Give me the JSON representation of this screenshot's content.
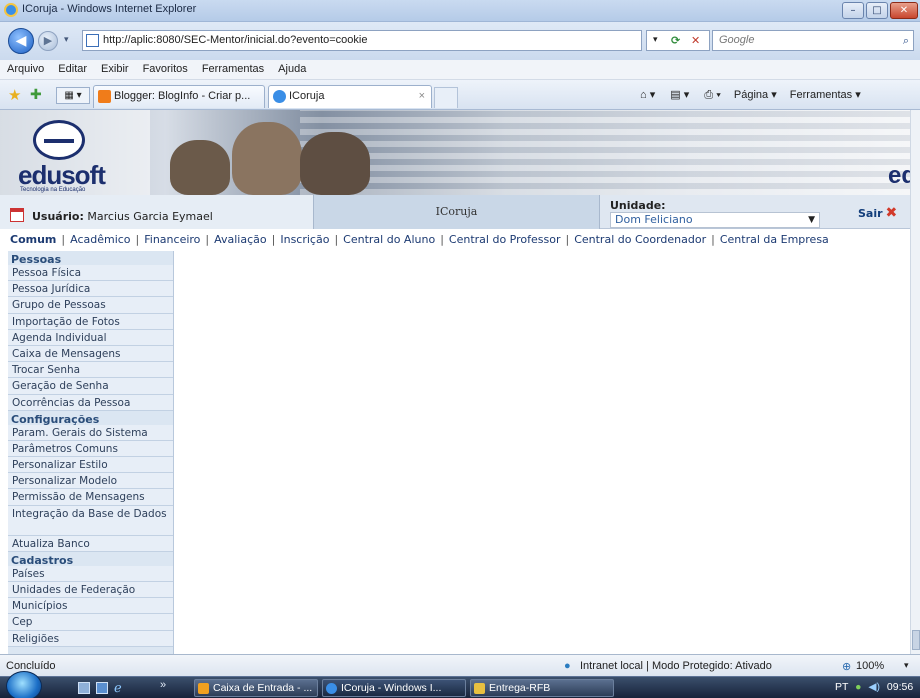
{
  "window": {
    "title": "ICoruja - Windows Internet Explorer",
    "min_label": "–",
    "max_label": "□",
    "close_label": "✕"
  },
  "address": {
    "back_label": "◀",
    "forward_label": "▶",
    "url": "http://aplic:8080/SEC-Mentor/inicial.do?evento=cookie",
    "refresh_label": "⟳",
    "stop_label": "✕",
    "dropdown_label": "▾",
    "search_placeholder": "Google",
    "search_icon": "⌕"
  },
  "menu": [
    "Arquivo",
    "Editar",
    "Exibir",
    "Favoritos",
    "Ferramentas",
    "Ajuda"
  ],
  "tabs": [
    {
      "label": "Blogger: BlogInfo - Criar p...",
      "color": "#f07c1a"
    },
    {
      "label": "ICoruja",
      "color": "#3a8ee6"
    }
  ],
  "tab_close": "×",
  "toolbar_right": {
    "home": "⌂ ▾",
    "feeds": "▤ ▾",
    "print": "⎙ ▾",
    "page": "Página ▾",
    "tools": "Ferramentas ▾"
  },
  "banner": {
    "logo_text": "edusoft",
    "tagline": "Tecnologia na Educação",
    "logo_right": "ed"
  },
  "user": {
    "label": "Usuário:",
    "name": "Marcius Garcia Eymael",
    "app_name": "ICoruja",
    "unidade_label": "Unidade:",
    "unidade_value": "Dom Feliciano",
    "logout_label": "Sair",
    "logout_icon": "✖"
  },
  "modules": [
    "Comum",
    "Acadêmico",
    "Financeiro",
    "Avaliação",
    "Inscrição",
    "Central do Aluno",
    "Central do Professor",
    "Central do Coordenador",
    "Central da Empresa"
  ],
  "sidebar": {
    "sections": [
      {
        "title": "Pessoas",
        "items": [
          "Pessoa Física",
          "Pessoa Jurídica",
          "Grupo de Pessoas",
          "Importação de Fotos",
          "Agenda Individual",
          "Caixa de Mensagens",
          "Trocar Senha",
          "Geração de Senha",
          "Ocorrências da Pessoa"
        ]
      },
      {
        "title": "Configurações",
        "items": [
          "Param. Gerais do Sistema",
          "Parâmetros Comuns",
          "Personalizar Estilo",
          "Personalizar Modelo",
          "Permissão de Mensagens",
          "Integração da Base de Dados",
          "Atualiza Banco"
        ]
      },
      {
        "title": "Cadastros",
        "items": [
          "Países",
          "Unidades de Federação",
          "Municípios",
          "Cep",
          "Religiões"
        ]
      }
    ]
  },
  "status": {
    "left": "Concluído",
    "zone": "Intranet local | Modo Protegido: Ativado",
    "zoom": "100%"
  },
  "taskbar": {
    "items": [
      {
        "label": "Caixa de Entrada - ...",
        "color": "#f0a020"
      },
      {
        "label": "ICoruja - Windows I...",
        "color": "#3a8ee6"
      },
      {
        "label": "Entrega-RFB",
        "color": "#e8c040"
      }
    ],
    "tray_lang": "PT",
    "clock": "09:56"
  }
}
